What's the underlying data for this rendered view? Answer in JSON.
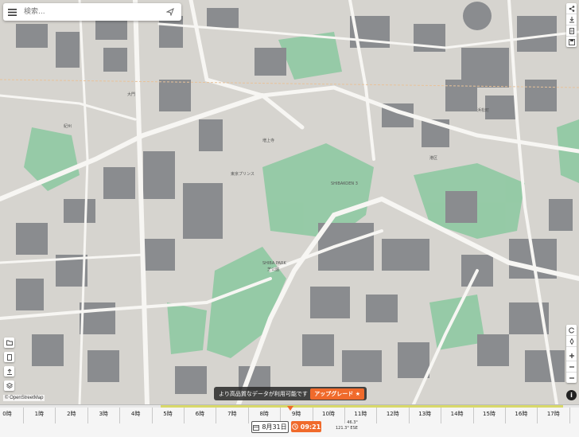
{
  "search": {
    "placeholder": "検索..."
  },
  "map": {
    "labels": {
      "shiba_park_1": "SHIBA PARK",
      "shiba_park_2": "芝公園",
      "shibakoen": "SHIBAKOEN 3",
      "otemon": "大門",
      "kishu": "紀州",
      "tokyo_tower_area": "東京プリンス",
      "zojoji": "増上寺",
      "hamamatsu": "浜松町",
      "minato": "港区"
    },
    "colors": {
      "road": "#f7f6f3",
      "major_road": "#ffffff",
      "building": "#8a8c8f",
      "park": "#8fc9a2",
      "ground": "#d6d4cf"
    }
  },
  "attribution": "© OpenStreetMap",
  "banner": {
    "message": "より高品質なデータが利用可能です",
    "upgrade": "アップグレード ★"
  },
  "timeline": {
    "hours": [
      "0時",
      "1時",
      "2時",
      "3時",
      "4時",
      "5時",
      "6時",
      "7時",
      "8時",
      "9時",
      "10時",
      "11時",
      "12時",
      "13時",
      "14時",
      "15時",
      "16時",
      "17時"
    ],
    "date": "8月31日",
    "time": "09:21",
    "sun_altitude": "46.3°",
    "sun_azimuth": "121.3° ESE"
  },
  "icons": {
    "menu": "hamburger-icon",
    "send": "send-icon",
    "right_tools": [
      "share-icon",
      "download-icon",
      "document-icon",
      "save-icon"
    ],
    "left_tools": [
      "folder-icon",
      "document-icon",
      "share-icon",
      "layers-icon"
    ],
    "map_controls": [
      "rotate-icon",
      "compass-icon",
      "zoom-in-icon",
      "zoom-out-icon",
      "minus-icon",
      "info-icon"
    ]
  }
}
